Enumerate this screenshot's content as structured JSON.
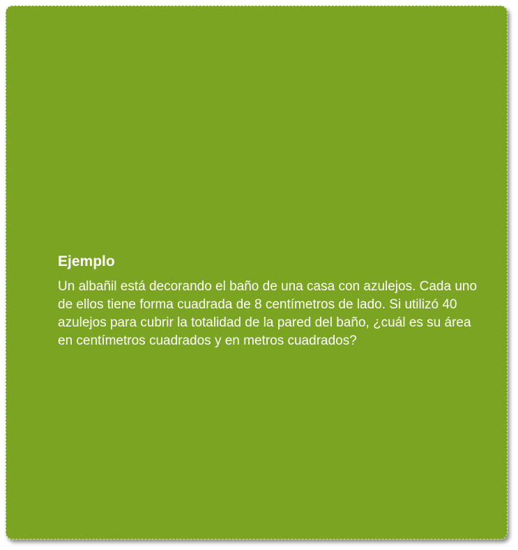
{
  "example": {
    "title": "Ejemplo",
    "body": "Un albañil está decorando el baño de una casa con azulejos. Cada uno de ellos tiene forma cuadrada de 8 centímetros de lado. Si utilizó 40 azulejos para cubrir la totalidad de la pared del baño, ¿cuál es su área en centímetros cuadrados y en metros cuadrados?"
  },
  "colors": {
    "background": "#7ba423",
    "text": "#ffffff"
  }
}
